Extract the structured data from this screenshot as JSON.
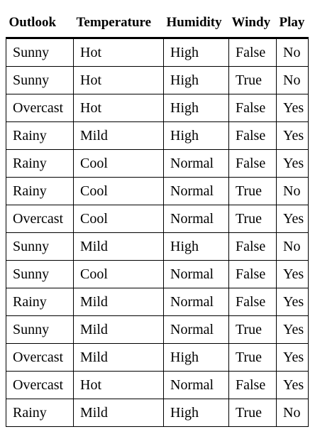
{
  "table": {
    "headers": [
      "Outlook",
      "Temperature",
      "Humidity",
      "Windy",
      "Play"
    ],
    "rows": [
      [
        "Sunny",
        "Hot",
        "High",
        "False",
        "No"
      ],
      [
        "Sunny",
        "Hot",
        "High",
        "True",
        "No"
      ],
      [
        "Overcast",
        "Hot",
        "High",
        "False",
        "Yes"
      ],
      [
        "Rainy",
        "Mild",
        "High",
        "False",
        "Yes"
      ],
      [
        "Rainy",
        "Cool",
        "Normal",
        "False",
        "Yes"
      ],
      [
        "Rainy",
        "Cool",
        "Normal",
        "True",
        "No"
      ],
      [
        "Overcast",
        "Cool",
        "Normal",
        "True",
        "Yes"
      ],
      [
        "Sunny",
        "Mild",
        "High",
        "False",
        "No"
      ],
      [
        "Sunny",
        "Cool",
        "Normal",
        "False",
        "Yes"
      ],
      [
        "Rainy",
        "Mild",
        "Normal",
        "False",
        "Yes"
      ],
      [
        "Sunny",
        "Mild",
        "Normal",
        "True",
        "Yes"
      ],
      [
        "Overcast",
        "Mild",
        "High",
        "True",
        "Yes"
      ],
      [
        "Overcast",
        "Hot",
        "Normal",
        "False",
        "Yes"
      ],
      [
        "Rainy",
        "Mild",
        "High",
        "True",
        "No"
      ]
    ]
  }
}
